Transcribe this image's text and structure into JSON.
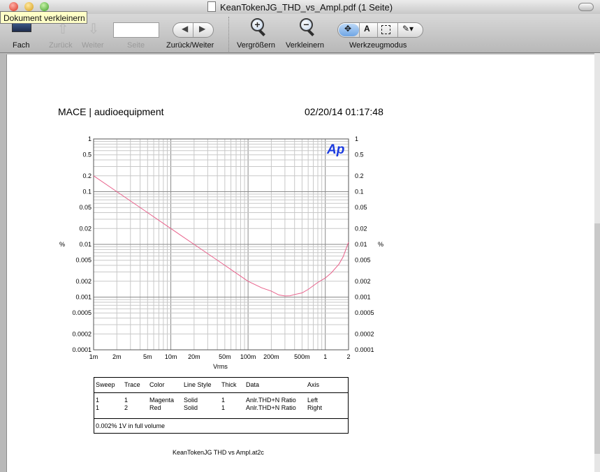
{
  "window": {
    "title": "KeanTokenJG_THD_vs_Ampl.pdf (1 Seite)"
  },
  "tooltip": "Dokument verkleinern",
  "toolbar": {
    "fach": "Fach",
    "zurueck": "Zurück",
    "weiter": "Weiter",
    "seite": "Seite",
    "zurueck_weiter": "Zurück/Weiter",
    "vergroessern": "Vergrößern",
    "verkleinern": "Verkleinern",
    "werkzeugmodus": "Werkzeugmodus",
    "text_tool_glyph": "A"
  },
  "document": {
    "header_left": "MACE | audioequipment",
    "header_right": "02/20/14 01:17:48",
    "logo": "Ap",
    "footer": "KeanTokenJG THD vs Ampl.at2c"
  },
  "legend": {
    "headers": [
      "Sweep",
      "Trace",
      "Color",
      "Line Style",
      "Thick",
      "Data",
      "Axis"
    ],
    "rows": [
      [
        "1",
        "1",
        "Magenta",
        "Solid",
        "1",
        "Anlr.THD+N Ratio",
        "Left"
      ],
      [
        "1",
        "2",
        "Red",
        "Solid",
        "1",
        "Anlr.THD+N Ratio",
        "Right"
      ]
    ],
    "note": "0.002% 1V in full volume"
  },
  "chart_data": {
    "type": "line",
    "title": "",
    "xlabel": "Vrms",
    "ylabel": "%",
    "ylabel_right": "%",
    "x_scale": "log",
    "y_scale": "log",
    "xlim": [
      0.001,
      2
    ],
    "ylim": [
      0.0001,
      1
    ],
    "grid": true,
    "x_ticks": [
      {
        "v": 0.001,
        "label": "1m"
      },
      {
        "v": 0.002,
        "label": "2m"
      },
      {
        "v": 0.005,
        "label": "5m"
      },
      {
        "v": 0.01,
        "label": "10m"
      },
      {
        "v": 0.02,
        "label": "20m"
      },
      {
        "v": 0.05,
        "label": "50m"
      },
      {
        "v": 0.1,
        "label": "100m"
      },
      {
        "v": 0.2,
        "label": "200m"
      },
      {
        "v": 0.5,
        "label": "500m"
      },
      {
        "v": 1,
        "label": "1"
      },
      {
        "v": 2,
        "label": "2"
      }
    ],
    "y_ticks": [
      {
        "v": 1,
        "label": "1"
      },
      {
        "v": 0.5,
        "label": "0.5"
      },
      {
        "v": 0.2,
        "label": "0.2"
      },
      {
        "v": 0.1,
        "label": "0.1"
      },
      {
        "v": 0.05,
        "label": "0.05"
      },
      {
        "v": 0.02,
        "label": "0.02"
      },
      {
        "v": 0.01,
        "label": "0.01"
      },
      {
        "v": 0.005,
        "label": "0.005"
      },
      {
        "v": 0.002,
        "label": "0.002"
      },
      {
        "v": 0.001,
        "label": "0.001"
      },
      {
        "v": 0.0005,
        "label": "0.0005"
      },
      {
        "v": 0.0002,
        "label": "0.0002"
      },
      {
        "v": 0.0001,
        "label": "0.0001"
      }
    ],
    "series": [
      {
        "color": "#e8608a",
        "x": [
          0.001,
          0.002,
          0.005,
          0.01,
          0.02,
          0.05,
          0.1,
          0.15,
          0.2,
          0.25,
          0.3,
          0.35,
          0.4,
          0.5,
          0.6,
          0.8,
          1.0,
          1.2,
          1.5,
          1.7,
          2.0
        ],
        "y": [
          0.2,
          0.1,
          0.04,
          0.02,
          0.01,
          0.004,
          0.002,
          0.0015,
          0.0013,
          0.0011,
          0.00105,
          0.00106,
          0.00112,
          0.0012,
          0.0014,
          0.0019,
          0.0023,
          0.0029,
          0.0042,
          0.0058,
          0.011
        ]
      }
    ]
  }
}
